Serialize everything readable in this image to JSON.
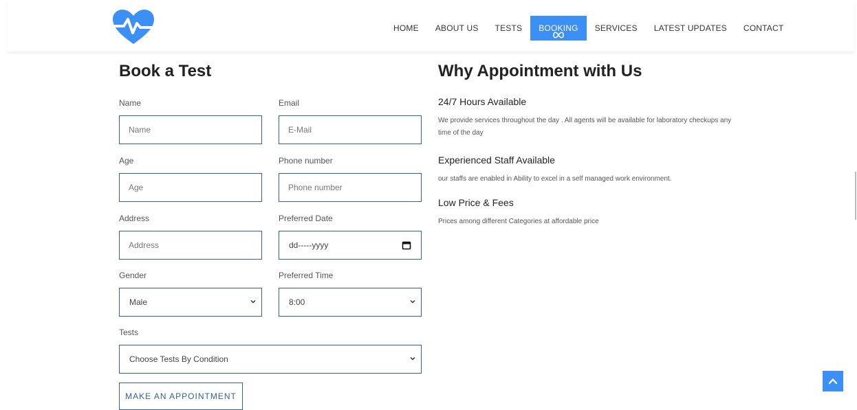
{
  "nav": {
    "items": [
      "HOME",
      "ABOUT US",
      "TESTS",
      "BOOKING",
      "SERVICES",
      "LATEST UPDATES",
      "CONTACT"
    ],
    "active": "BOOKING"
  },
  "form": {
    "title": "Book a Test",
    "name_label": "Name",
    "name_placeholder": "Name",
    "email_label": "Email",
    "email_placeholder": "E-Mail",
    "age_label": "Age",
    "age_placeholder": "Age",
    "phone_label": "Phone number",
    "phone_placeholder": "Phone number",
    "address_label": "Address",
    "address_placeholder": "Address",
    "date_label": "Preferred Date",
    "date_placeholder": "dd-----yyyy",
    "gender_label": "Gender",
    "gender_value": "Male",
    "time_label": "Preferred Time",
    "time_value": "8:00",
    "tests_label": "Tests",
    "tests_value": "Choose Tests By Condition",
    "submit_label": "MAKE AN APPOINTMENT"
  },
  "why": {
    "title": "Why Appointment with Us",
    "items": [
      {
        "heading": "24/7 Hours Available",
        "text": "We provide services throughout the day . All agents will be available for laboratory checkups any time of the day"
      },
      {
        "heading": "Experienced Staff Available",
        "text": "our staffs are enabled in Ability to excel in a self managed work environment."
      },
      {
        "heading": "Low Price & Fees",
        "text": "Prices among different Categories at affordable price"
      }
    ]
  },
  "colors": {
    "accent": "#3b8ff5",
    "border": "#335f95"
  },
  "icons": {
    "logo": "heart-pulse-icon",
    "date": "calendar-icon",
    "select": "chevron-down-icon",
    "scroll_top": "chevron-up-icon"
  }
}
